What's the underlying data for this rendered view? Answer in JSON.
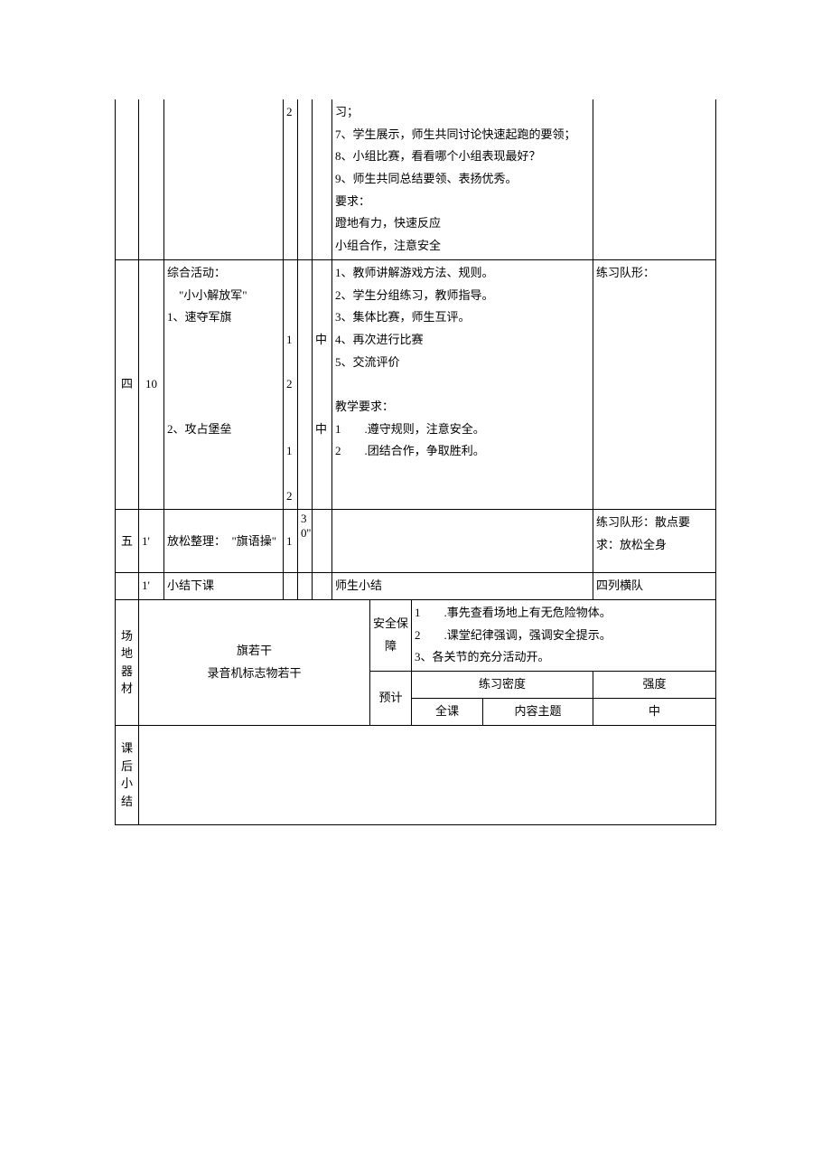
{
  "row1": {
    "col4": "2",
    "col7_lines": [
      "习；",
      "7、学生展示，师生共同讨论快速起跑的要领；",
      "8、小组比赛，看看哪个小组表现最好？",
      "9、师生共同总结要领、表扬优秀。",
      "要求：",
      "蹬地有力，快速反应",
      "小组合作，注意安全"
    ]
  },
  "row2": {
    "col1": "四",
    "col2": "10",
    "col3_lines": [
      "综合活动：",
      "　\"小小解放军\"",
      "1、速夺军旗",
      "",
      "",
      "",
      "",
      "2、攻占堡垒"
    ],
    "col4_lines": [
      "",
      "",
      "",
      "1",
      "",
      "2",
      "",
      "",
      "1",
      "",
      "2"
    ],
    "col6_lines": [
      "",
      "",
      "",
      "中",
      "",
      "",
      "",
      "中"
    ],
    "col7_lines": [
      "1、教师讲解游戏方法、规则。",
      "2、学生分组练习，教师指导。",
      "3、集体比赛，师生互评。",
      "4、再次进行比赛",
      "5、交流评价",
      "",
      "教学要求：",
      "1　　.遵守规则，注意安全。",
      "2　　.团结合作，争取胜利。"
    ],
    "col8": "练习队形："
  },
  "row3": {
    "col1": "五",
    "col2": "1'",
    "col3": "放松整理：　\"旗语操\"",
    "col4": "1",
    "col5": "30''",
    "col8": "练习队形：散点要求：放松全身"
  },
  "row4": {
    "col2": "1'",
    "col3": "小结下课",
    "col7": "师生小结",
    "col8": "四列横队"
  },
  "row5": {
    "label": "场地器材",
    "content": "旗若干\n录音机标志物若干",
    "safety_label": "安全保障",
    "safety_lines": [
      "1　　.事先查看场地上有无危险物体。",
      "2　　.课堂纪律强调，强调安全提示。",
      "3、各关节的充分活动开。"
    ],
    "forecast": "预计",
    "density": "练习密度",
    "intensity": "强度",
    "whole_class": "全课",
    "content_subject": "内容主题",
    "intensity_val": "中"
  },
  "row6": {
    "label": "课后小结"
  }
}
